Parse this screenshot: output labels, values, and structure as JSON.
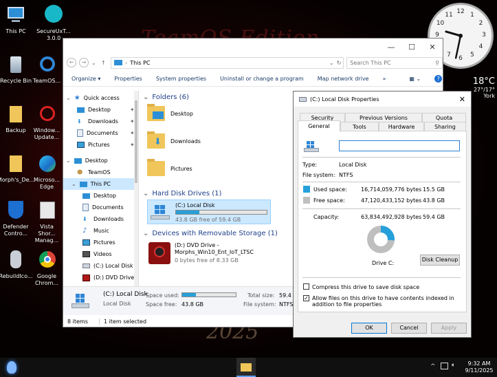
{
  "desktop": {
    "wallpaper_title": "TeamOS Edition",
    "wallpaper_year": "2025",
    "icons": [
      {
        "label": "This PC"
      },
      {
        "label": "SecureUxT... 3.0.0"
      },
      {
        "label": "Recycle Bin"
      },
      {
        "label": "TeamOS..."
      },
      {
        "label": "Backup"
      },
      {
        "label": "Window... Update..."
      },
      {
        "label": "Morph's_De..."
      },
      {
        "label": "Microso... Edge"
      },
      {
        "label": "Defender Contro..."
      },
      {
        "label": "Vista Shor... Manag..."
      },
      {
        "label": "RebuildIco..."
      },
      {
        "label": "Google Chrom..."
      }
    ]
  },
  "clock_widget": {
    "numbers": [
      "12",
      "1",
      "2",
      "3",
      "4",
      "5",
      "6",
      "7",
      "8",
      "9",
      "10",
      "11"
    ],
    "hour": 9,
    "minute": 32
  },
  "weather": {
    "temp": "18°C",
    "range": "27°/17°",
    "city": "York"
  },
  "explorer": {
    "address": "This PC",
    "search_placeholder": "Search This PC",
    "ribbon": [
      "Organize ▾",
      "Properties",
      "System properties",
      "Uninstall or change a program",
      "Map network drive",
      "»"
    ],
    "nav": {
      "quick_access": "Quick access",
      "quick_items": [
        "Desktop",
        "Downloads",
        "Documents",
        "Pictures"
      ],
      "desktop": "Desktop",
      "desktop_children": [
        "TeamOS",
        "This PC"
      ],
      "thispc_children": [
        "Desktop",
        "Documents",
        "Downloads",
        "Music",
        "Pictures",
        "Videos",
        "(C:) Local Disk",
        "(D:) DVD Drive ..."
      ]
    },
    "folders_header": "Folders (6)",
    "folders": [
      "Desktop",
      "Downloads",
      "Pictures"
    ],
    "hdd_header": "Hard Disk Drives (1)",
    "hdd": {
      "name": "(C:) Local Disk",
      "free": "43.8 GB free of 59.4 GB",
      "used_fraction": 0.26
    },
    "removable_header": "Devices with Removable Storage (1)",
    "dvd": {
      "name": "(D:) DVD Drive - Morphs_Win10_Ent_IoT_LTSC",
      "free": "0 bytes free of 8.33 GB"
    },
    "details": {
      "name": "(C:) Local Disk",
      "type": "Local Disk",
      "space_used_label": "Space used:",
      "space_free_label": "Space free:",
      "space_free": "43.8 GB",
      "total_label": "Total size:",
      "total": "59.4 ...",
      "fs_label": "File system:",
      "fs": "NTFS",
      "used_fraction": 0.26
    },
    "status": {
      "items": "8 items",
      "selected": "1 item selected"
    }
  },
  "props": {
    "title": "(C:) Local Disk Properties",
    "tabs_top": [
      "Security",
      "Previous Versions",
      "Quota"
    ],
    "tabs_bottom": [
      "General",
      "Tools",
      "Hardware",
      "Sharing"
    ],
    "type_label": "Type:",
    "type": "Local Disk",
    "fs_label": "File system:",
    "fs": "NTFS",
    "used_label": "Used space:",
    "used_bytes": "16,714,059,776 bytes",
    "used_gb": "15.5 GB",
    "free_label": "Free space:",
    "free_bytes": "47,120,433,152 bytes",
    "free_gb": "43.8 GB",
    "cap_label": "Capacity:",
    "cap_bytes": "63,834,492,928 bytes",
    "cap_gb": "59.4 GB",
    "drive_label": "Drive C:",
    "cleanup": "Disk Cleanup",
    "compress": "Compress this drive to save disk space",
    "index": "Allow files on this drive to have contents indexed in addition to file properties",
    "ok": "OK",
    "cancel": "Cancel",
    "apply": "Apply",
    "used_fraction": 0.262,
    "colors": {
      "used": "#26a0da",
      "free": "#bfbfbf"
    }
  },
  "taskbar": {
    "time": "9:32 AM",
    "date": "9/11/2025"
  }
}
